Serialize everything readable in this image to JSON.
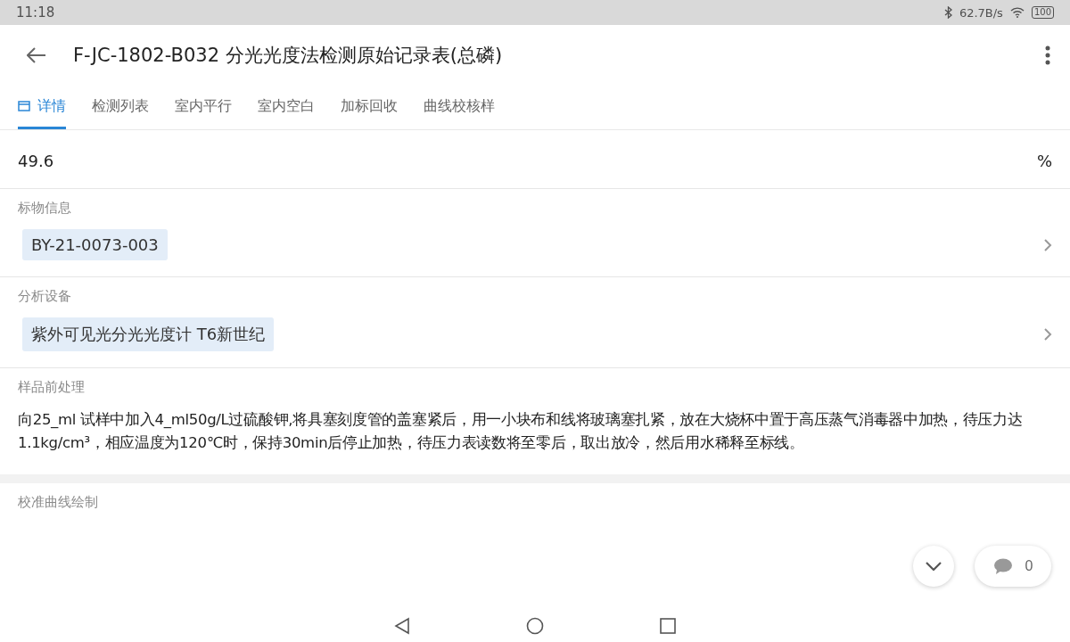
{
  "status_bar": {
    "time": "11:18",
    "speed": "62.7B/s",
    "battery": "100"
  },
  "header": {
    "title": "F-JC-1802-B032 分光光度法检测原始记录表(总磷)"
  },
  "tabs": [
    {
      "label": "详情",
      "selected": true,
      "kind": "icon"
    },
    {
      "label": "检测列表",
      "selected": false,
      "kind": "text"
    },
    {
      "label": "室内平行",
      "selected": false,
      "kind": "text"
    },
    {
      "label": "室内空白",
      "selected": false,
      "kind": "text"
    },
    {
      "label": "加标回收",
      "selected": false,
      "kind": "text"
    },
    {
      "label": "曲线校核样",
      "selected": false,
      "kind": "text"
    }
  ],
  "sections": [
    {
      "kind": "value",
      "value": "49.6",
      "unit": "%"
    },
    {
      "kind": "chip",
      "label": "标物信息",
      "chip": "BY-21-0073-003"
    },
    {
      "kind": "chip",
      "label": "分析设备",
      "chip": "紫外可见光分光光度计 T6新世纪"
    },
    {
      "kind": "text",
      "label": "样品前处理",
      "text": "向25_ml 试样中加入4_ml50g/L过硫酸钾,将具塞刻度管的盖塞紧后，用一小块布和线将玻璃塞扎紧，放在大烧杯中置于高压蒸气消毒器中加热，待压力达1.1kg/cm³，相应温度为120℃时，保持30min后停止加热，待压力表读数将至零后，取出放冷，然后用水稀释至标线。"
    },
    {
      "kind": "heading",
      "label": "校准曲线绘制"
    }
  ],
  "comments": {
    "count": "0"
  }
}
